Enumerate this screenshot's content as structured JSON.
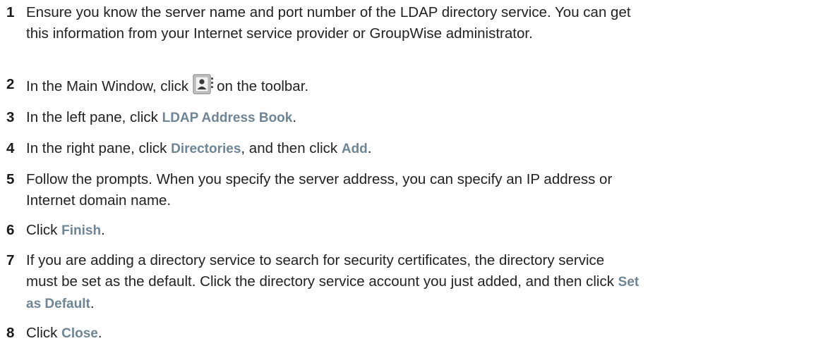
{
  "steps": [
    {
      "number": "1",
      "line1": "Ensure you know the server name and port number of the LDAP directory service. You can get",
      "line2": "this information from your Internet service provider or GroupWise administrator."
    },
    {
      "number": "2",
      "before": "In the Main Window, click",
      "icon": "address-book-icon",
      "after": "on the toolbar."
    },
    {
      "number": "3",
      "before": "In the left pane, click",
      "ui1": "LDAP Address Book",
      "after": "."
    },
    {
      "number": "4",
      "before": "In the right pane, click",
      "ui1": "Directories",
      "middle": ", and then click",
      "ui2": "Add",
      "after": "."
    },
    {
      "number": "5",
      "line1": "Follow the prompts. When you specify the server address, you can specify an IP address or",
      "line2": "Internet domain name."
    },
    {
      "number": "6",
      "before": "Click",
      "ui1": "Finish",
      "after": "."
    },
    {
      "number": "7",
      "line1": "If you are adding a directory service to search for security certificates, the directory service",
      "line2_before": "must be set as the default. Click the directory service account you just added, and then click",
      "ui1_line2": "Set",
      "ui1_line3": "as Default",
      "after": "."
    },
    {
      "number": "8",
      "before": "Click",
      "ui1": "Close",
      "after": "."
    }
  ],
  "colors": {
    "ui_label": "#6e8596",
    "text": "#222222"
  }
}
